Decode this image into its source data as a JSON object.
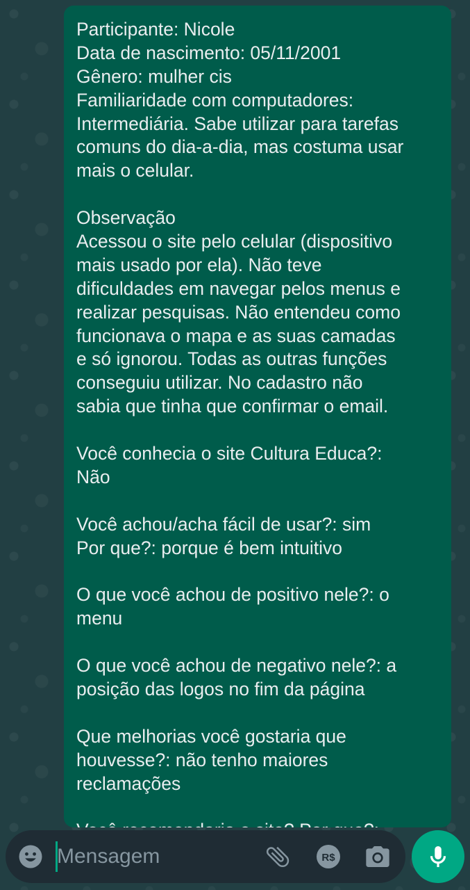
{
  "message": {
    "lines": [
      "Participante: Nicole",
      "Data de nascimento: 05/11/2001",
      "Gênero: mulher cis",
      "Familiaridade com computadores:",
      "Intermediária. Sabe utilizar para tarefas",
      "comuns do dia-a-dia, mas costuma usar",
      "mais o celular.",
      "",
      "Observação",
      "Acessou o site pelo celular (dispositivo",
      "mais usado por ela). Não teve",
      "dificuldades em navegar pelos menus e",
      "realizar pesquisas. Não entendeu como",
      "funcionava o mapa e as suas camadas",
      "e só ignorou. Todas as outras funções",
      "conseguiu utilizar. No cadastro não",
      "sabia que tinha que confirmar o email.",
      "",
      "Você conhecia o site Cultura Educa?:",
      "Não",
      "",
      "Você achou/acha fácil de usar?: sim",
      "Por que?: porque é bem intuitivo",
      "",
      "O que você achou de positivo nele?: o",
      "menu",
      "",
      "O que você achou de negativo nele?: a",
      "posição das logos no fim da página",
      "",
      "Que melhorias você gostaria que",
      "houvesse?: não tenho maiores",
      "reclamações",
      "",
      "Você recomendaria o site? Por que?:"
    ]
  },
  "composer": {
    "placeholder": "Mensagem",
    "value": "",
    "icons": {
      "emoji": "emoji-icon",
      "attach": "paperclip-icon",
      "payment": "payment-icon",
      "camera": "camera-icon",
      "mic": "microphone-icon"
    },
    "payment_label": "R$"
  },
  "colors": {
    "chat_background": "#223f43",
    "bubble_outgoing": "#005c4b",
    "message_text": "#e9edef",
    "composer_background": "#1f2c34",
    "icon_gray": "#8696a0",
    "accent": "#00a884"
  }
}
